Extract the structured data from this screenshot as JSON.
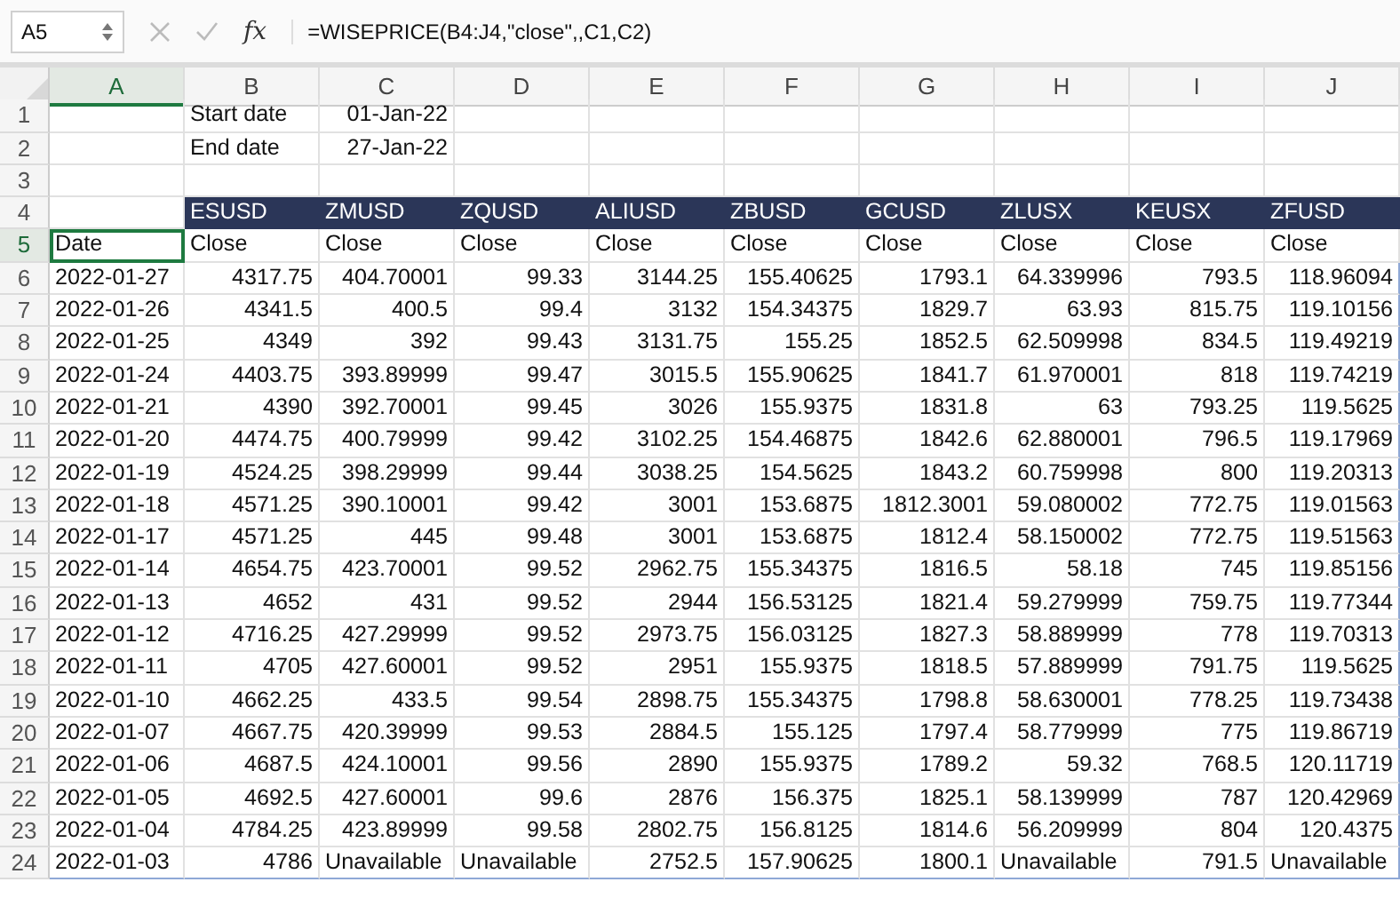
{
  "formula_bar": {
    "name_box": "A5",
    "fx_label": "fx",
    "formula": "=WISEPRICE(B4:J4,\"close\",,C1,C2)"
  },
  "columns": [
    {
      "label": "A",
      "selected": true
    },
    {
      "label": "B",
      "selected": false
    },
    {
      "label": "C",
      "selected": false
    },
    {
      "label": "D",
      "selected": false
    },
    {
      "label": "E",
      "selected": false
    },
    {
      "label": "F",
      "selected": false
    },
    {
      "label": "G",
      "selected": false
    },
    {
      "label": "H",
      "selected": false
    },
    {
      "label": "I",
      "selected": false
    },
    {
      "label": "J",
      "selected": false
    }
  ],
  "row_numbers": [
    {
      "label": "1",
      "selected": false
    },
    {
      "label": "2",
      "selected": false
    },
    {
      "label": "3",
      "selected": false
    },
    {
      "label": "4",
      "selected": false
    },
    {
      "label": "5",
      "selected": true
    },
    {
      "label": "6",
      "selected": false
    },
    {
      "label": "7",
      "selected": false
    },
    {
      "label": "8",
      "selected": false
    },
    {
      "label": "9",
      "selected": false
    },
    {
      "label": "10",
      "selected": false
    },
    {
      "label": "11",
      "selected": false
    },
    {
      "label": "12",
      "selected": false
    },
    {
      "label": "13",
      "selected": false
    },
    {
      "label": "14",
      "selected": false
    },
    {
      "label": "15",
      "selected": false
    },
    {
      "label": "16",
      "selected": false
    },
    {
      "label": "17",
      "selected": false
    },
    {
      "label": "18",
      "selected": false
    },
    {
      "label": "19",
      "selected": false
    },
    {
      "label": "20",
      "selected": false
    },
    {
      "label": "21",
      "selected": false
    },
    {
      "label": "22",
      "selected": false
    },
    {
      "label": "23",
      "selected": false
    },
    {
      "label": "24",
      "selected": false
    }
  ],
  "parameters": [
    {
      "label": "Start date",
      "value": "01-Jan-22"
    },
    {
      "label": "End date",
      "value": "27-Jan-22"
    }
  ],
  "tickers": [
    "ESUSD",
    "ZMUSD",
    "ZQUSD",
    "ALIUSD",
    "ZBUSD",
    "GCUSD",
    "ZLUSX",
    "KEUSX",
    "ZFUSD"
  ],
  "field_row": {
    "date_label": "Date",
    "active": true,
    "fields": [
      "Close",
      "Close",
      "Close",
      "Close",
      "Close",
      "Close",
      "Close",
      "Close",
      "Close"
    ]
  },
  "data": [
    {
      "date": "2022-01-27",
      "values": [
        {
          "text": "4317.75",
          "kind": "number"
        },
        {
          "text": "404.70001",
          "kind": "number"
        },
        {
          "text": "99.33",
          "kind": "number"
        },
        {
          "text": "3144.25",
          "kind": "number"
        },
        {
          "text": "155.40625",
          "kind": "number"
        },
        {
          "text": "1793.1",
          "kind": "number"
        },
        {
          "text": "64.339996",
          "kind": "number"
        },
        {
          "text": "793.5",
          "kind": "number"
        },
        {
          "text": "118.96094",
          "kind": "number"
        }
      ]
    },
    {
      "date": "2022-01-26",
      "values": [
        {
          "text": "4341.5",
          "kind": "number"
        },
        {
          "text": "400.5",
          "kind": "number"
        },
        {
          "text": "99.4",
          "kind": "number"
        },
        {
          "text": "3132",
          "kind": "number"
        },
        {
          "text": "154.34375",
          "kind": "number"
        },
        {
          "text": "1829.7",
          "kind": "number"
        },
        {
          "text": "63.93",
          "kind": "number"
        },
        {
          "text": "815.75",
          "kind": "number"
        },
        {
          "text": "119.10156",
          "kind": "number"
        }
      ]
    },
    {
      "date": "2022-01-25",
      "values": [
        {
          "text": "4349",
          "kind": "number"
        },
        {
          "text": "392",
          "kind": "number"
        },
        {
          "text": "99.43",
          "kind": "number"
        },
        {
          "text": "3131.75",
          "kind": "number"
        },
        {
          "text": "155.25",
          "kind": "number"
        },
        {
          "text": "1852.5",
          "kind": "number"
        },
        {
          "text": "62.509998",
          "kind": "number"
        },
        {
          "text": "834.5",
          "kind": "number"
        },
        {
          "text": "119.49219",
          "kind": "number"
        }
      ]
    },
    {
      "date": "2022-01-24",
      "values": [
        {
          "text": "4403.75",
          "kind": "number"
        },
        {
          "text": "393.89999",
          "kind": "number"
        },
        {
          "text": "99.47",
          "kind": "number"
        },
        {
          "text": "3015.5",
          "kind": "number"
        },
        {
          "text": "155.90625",
          "kind": "number"
        },
        {
          "text": "1841.7",
          "kind": "number"
        },
        {
          "text": "61.970001",
          "kind": "number"
        },
        {
          "text": "818",
          "kind": "number"
        },
        {
          "text": "119.74219",
          "kind": "number"
        }
      ]
    },
    {
      "date": "2022-01-21",
      "values": [
        {
          "text": "4390",
          "kind": "number"
        },
        {
          "text": "392.70001",
          "kind": "number"
        },
        {
          "text": "99.45",
          "kind": "number"
        },
        {
          "text": "3026",
          "kind": "number"
        },
        {
          "text": "155.9375",
          "kind": "number"
        },
        {
          "text": "1831.8",
          "kind": "number"
        },
        {
          "text": "63",
          "kind": "number"
        },
        {
          "text": "793.25",
          "kind": "number"
        },
        {
          "text": "119.5625",
          "kind": "number"
        }
      ]
    },
    {
      "date": "2022-01-20",
      "values": [
        {
          "text": "4474.75",
          "kind": "number"
        },
        {
          "text": "400.79999",
          "kind": "number"
        },
        {
          "text": "99.42",
          "kind": "number"
        },
        {
          "text": "3102.25",
          "kind": "number"
        },
        {
          "text": "154.46875",
          "kind": "number"
        },
        {
          "text": "1842.6",
          "kind": "number"
        },
        {
          "text": "62.880001",
          "kind": "number"
        },
        {
          "text": "796.5",
          "kind": "number"
        },
        {
          "text": "119.17969",
          "kind": "number"
        }
      ]
    },
    {
      "date": "2022-01-19",
      "values": [
        {
          "text": "4524.25",
          "kind": "number"
        },
        {
          "text": "398.29999",
          "kind": "number"
        },
        {
          "text": "99.44",
          "kind": "number"
        },
        {
          "text": "3038.25",
          "kind": "number"
        },
        {
          "text": "154.5625",
          "kind": "number"
        },
        {
          "text": "1843.2",
          "kind": "number"
        },
        {
          "text": "60.759998",
          "kind": "number"
        },
        {
          "text": "800",
          "kind": "number"
        },
        {
          "text": "119.20313",
          "kind": "number"
        }
      ]
    },
    {
      "date": "2022-01-18",
      "values": [
        {
          "text": "4571.25",
          "kind": "number"
        },
        {
          "text": "390.10001",
          "kind": "number"
        },
        {
          "text": "99.42",
          "kind": "number"
        },
        {
          "text": "3001",
          "kind": "number"
        },
        {
          "text": "153.6875",
          "kind": "number"
        },
        {
          "text": "1812.3001",
          "kind": "number"
        },
        {
          "text": "59.080002",
          "kind": "number"
        },
        {
          "text": "772.75",
          "kind": "number"
        },
        {
          "text": "119.01563",
          "kind": "number"
        }
      ]
    },
    {
      "date": "2022-01-17",
      "values": [
        {
          "text": "4571.25",
          "kind": "number"
        },
        {
          "text": "445",
          "kind": "number"
        },
        {
          "text": "99.48",
          "kind": "number"
        },
        {
          "text": "3001",
          "kind": "number"
        },
        {
          "text": "153.6875",
          "kind": "number"
        },
        {
          "text": "1812.4",
          "kind": "number"
        },
        {
          "text": "58.150002",
          "kind": "number"
        },
        {
          "text": "772.75",
          "kind": "number"
        },
        {
          "text": "119.51563",
          "kind": "number"
        }
      ]
    },
    {
      "date": "2022-01-14",
      "values": [
        {
          "text": "4654.75",
          "kind": "number"
        },
        {
          "text": "423.70001",
          "kind": "number"
        },
        {
          "text": "99.52",
          "kind": "number"
        },
        {
          "text": "2962.75",
          "kind": "number"
        },
        {
          "text": "155.34375",
          "kind": "number"
        },
        {
          "text": "1816.5",
          "kind": "number"
        },
        {
          "text": "58.18",
          "kind": "number"
        },
        {
          "text": "745",
          "kind": "number"
        },
        {
          "text": "119.85156",
          "kind": "number"
        }
      ]
    },
    {
      "date": "2022-01-13",
      "values": [
        {
          "text": "4652",
          "kind": "number"
        },
        {
          "text": "431",
          "kind": "number"
        },
        {
          "text": "99.52",
          "kind": "number"
        },
        {
          "text": "2944",
          "kind": "number"
        },
        {
          "text": "156.53125",
          "kind": "number"
        },
        {
          "text": "1821.4",
          "kind": "number"
        },
        {
          "text": "59.279999",
          "kind": "number"
        },
        {
          "text": "759.75",
          "kind": "number"
        },
        {
          "text": "119.77344",
          "kind": "number"
        }
      ]
    },
    {
      "date": "2022-01-12",
      "values": [
        {
          "text": "4716.25",
          "kind": "number"
        },
        {
          "text": "427.29999",
          "kind": "number"
        },
        {
          "text": "99.52",
          "kind": "number"
        },
        {
          "text": "2973.75",
          "kind": "number"
        },
        {
          "text": "156.03125",
          "kind": "number"
        },
        {
          "text": "1827.3",
          "kind": "number"
        },
        {
          "text": "58.889999",
          "kind": "number"
        },
        {
          "text": "778",
          "kind": "number"
        },
        {
          "text": "119.70313",
          "kind": "number"
        }
      ]
    },
    {
      "date": "2022-01-11",
      "values": [
        {
          "text": "4705",
          "kind": "number"
        },
        {
          "text": "427.60001",
          "kind": "number"
        },
        {
          "text": "99.52",
          "kind": "number"
        },
        {
          "text": "2951",
          "kind": "number"
        },
        {
          "text": "155.9375",
          "kind": "number"
        },
        {
          "text": "1818.5",
          "kind": "number"
        },
        {
          "text": "57.889999",
          "kind": "number"
        },
        {
          "text": "791.75",
          "kind": "number"
        },
        {
          "text": "119.5625",
          "kind": "number"
        }
      ]
    },
    {
      "date": "2022-01-10",
      "values": [
        {
          "text": "4662.25",
          "kind": "number"
        },
        {
          "text": "433.5",
          "kind": "number"
        },
        {
          "text": "99.54",
          "kind": "number"
        },
        {
          "text": "2898.75",
          "kind": "number"
        },
        {
          "text": "155.34375",
          "kind": "number"
        },
        {
          "text": "1798.8",
          "kind": "number"
        },
        {
          "text": "58.630001",
          "kind": "number"
        },
        {
          "text": "778.25",
          "kind": "number"
        },
        {
          "text": "119.73438",
          "kind": "number"
        }
      ]
    },
    {
      "date": "2022-01-07",
      "values": [
        {
          "text": "4667.75",
          "kind": "number"
        },
        {
          "text": "420.39999",
          "kind": "number"
        },
        {
          "text": "99.53",
          "kind": "number"
        },
        {
          "text": "2884.5",
          "kind": "number"
        },
        {
          "text": "155.125",
          "kind": "number"
        },
        {
          "text": "1797.4",
          "kind": "number"
        },
        {
          "text": "58.779999",
          "kind": "number"
        },
        {
          "text": "775",
          "kind": "number"
        },
        {
          "text": "119.86719",
          "kind": "number"
        }
      ]
    },
    {
      "date": "2022-01-06",
      "values": [
        {
          "text": "4687.5",
          "kind": "number"
        },
        {
          "text": "424.10001",
          "kind": "number"
        },
        {
          "text": "99.56",
          "kind": "number"
        },
        {
          "text": "2890",
          "kind": "number"
        },
        {
          "text": "155.9375",
          "kind": "number"
        },
        {
          "text": "1789.2",
          "kind": "number"
        },
        {
          "text": "59.32",
          "kind": "number"
        },
        {
          "text": "768.5",
          "kind": "number"
        },
        {
          "text": "120.11719",
          "kind": "number"
        }
      ]
    },
    {
      "date": "2022-01-05",
      "values": [
        {
          "text": "4692.5",
          "kind": "number"
        },
        {
          "text": "427.60001",
          "kind": "number"
        },
        {
          "text": "99.6",
          "kind": "number"
        },
        {
          "text": "2876",
          "kind": "number"
        },
        {
          "text": "156.375",
          "kind": "number"
        },
        {
          "text": "1825.1",
          "kind": "number"
        },
        {
          "text": "58.139999",
          "kind": "number"
        },
        {
          "text": "787",
          "kind": "number"
        },
        {
          "text": "120.42969",
          "kind": "number"
        }
      ]
    },
    {
      "date": "2022-01-04",
      "values": [
        {
          "text": "4784.25",
          "kind": "number"
        },
        {
          "text": "423.89999",
          "kind": "number"
        },
        {
          "text": "99.58",
          "kind": "number"
        },
        {
          "text": "2802.75",
          "kind": "number"
        },
        {
          "text": "156.8125",
          "kind": "number"
        },
        {
          "text": "1814.6",
          "kind": "number"
        },
        {
          "text": "56.209999",
          "kind": "number"
        },
        {
          "text": "804",
          "kind": "number"
        },
        {
          "text": "120.4375",
          "kind": "number"
        }
      ]
    },
    {
      "date": "2022-01-03",
      "values": [
        {
          "text": "4786",
          "kind": "number"
        },
        {
          "text": "Unavailable",
          "kind": "text"
        },
        {
          "text": "Unavailable",
          "kind": "text"
        },
        {
          "text": "2752.5",
          "kind": "number"
        },
        {
          "text": "157.90625",
          "kind": "number"
        },
        {
          "text": "1800.1",
          "kind": "number"
        },
        {
          "text": "Unavailable",
          "kind": "text"
        },
        {
          "text": "791.5",
          "kind": "number"
        },
        {
          "text": "Unavailable",
          "kind": "text"
        }
      ]
    }
  ]
}
